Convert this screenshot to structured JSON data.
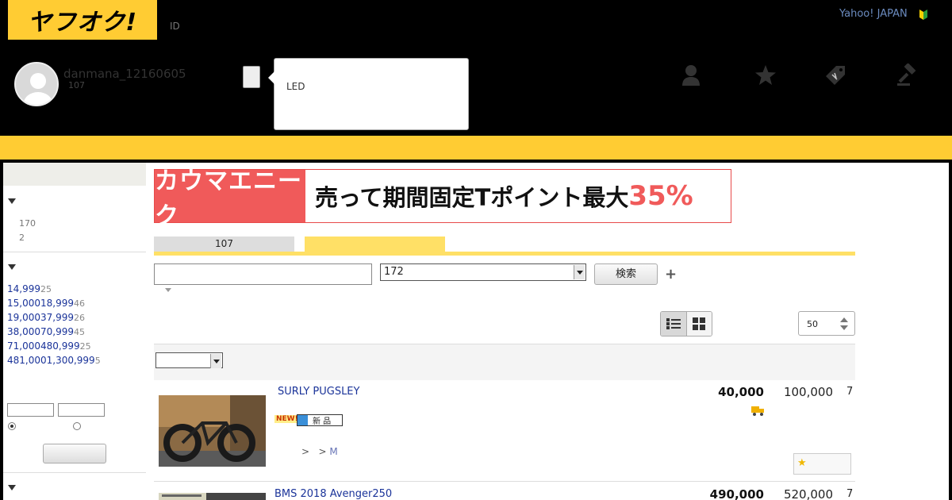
{
  "header": {
    "logo_text": "ヤフオク!",
    "id_label": "ID",
    "yahoo_japan_link": "Yahoo! JAPAN",
    "username": "danmana_12160605",
    "user_count": "107",
    "tooltip_text": "LED",
    "nav_icons": [
      "user-icon",
      "star-icon",
      "tag-icon",
      "gavel-icon"
    ]
  },
  "banner": {
    "left_text": "カウマエニーク",
    "right_text": "売って期間固定Tポイント最大",
    "accent_text": "35%"
  },
  "tabs": {
    "first_label": "107",
    "second_label": ""
  },
  "search": {
    "keyword_value": "",
    "category_value": "172",
    "search_button": "検索",
    "plus_label": "+"
  },
  "view": {
    "per_page": "50"
  },
  "sidebar": {
    "section1_counts": [
      "170",
      "2"
    ],
    "price_ranges": [
      {
        "label": "14,999",
        "count": "25"
      },
      {
        "label": "15,00018,999",
        "count": "46"
      },
      {
        "label": "19,00037,999",
        "count": "26"
      },
      {
        "label": "38,00070,999",
        "count": "45"
      },
      {
        "label": "71,000480,999",
        "count": "25"
      },
      {
        "label": "481,0001,300,999",
        "count": "5"
      }
    ]
  },
  "listings": [
    {
      "title": "SURLY  PUGSLEY",
      "price": "40,000",
      "buy_now": "100,000",
      "bids": "7",
      "badge_new": "NEW!",
      "badge_condition": "新 品",
      "crumb_sep1": ">",
      "crumb_sep2": ">",
      "crumb_last": "M",
      "watch_symbol": "★"
    },
    {
      "title": "BMS 2018 Avenger250",
      "price": "490,000",
      "buy_now": "520,000",
      "bids": "7"
    }
  ],
  "colors": {
    "brand_yellow": "#ffcc33",
    "link_blue": "#1a3399",
    "banner_red": "#f05a5a"
  }
}
